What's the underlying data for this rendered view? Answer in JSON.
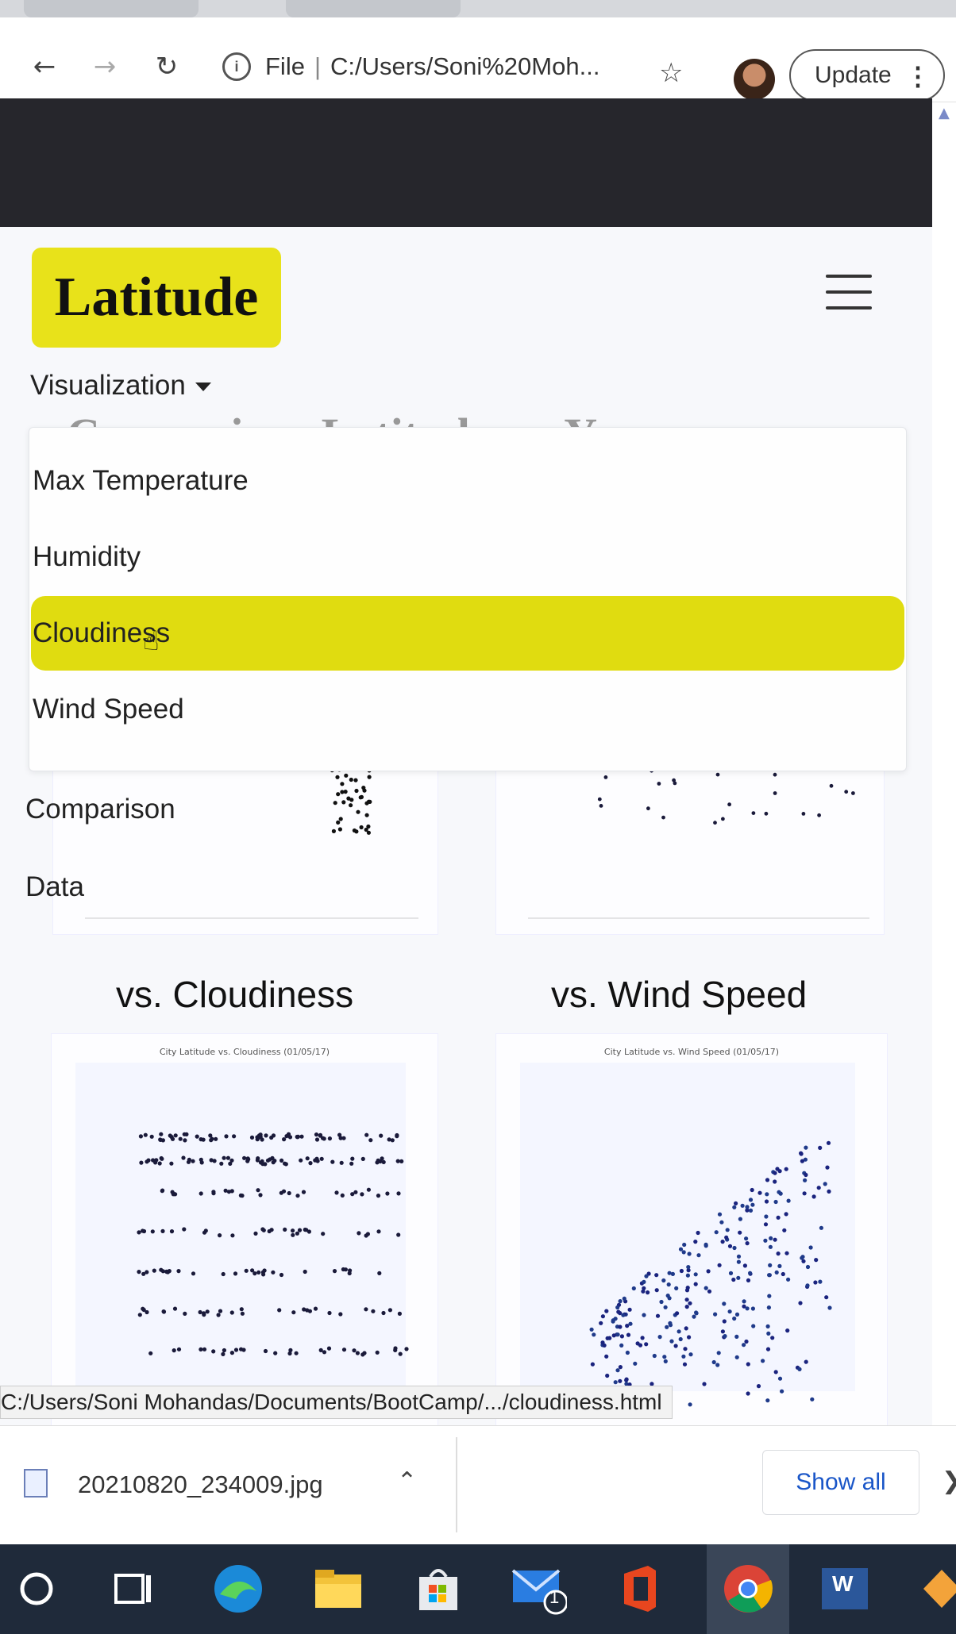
{
  "browser": {
    "address_prefix": "File",
    "address_path": "C:/Users/Soni%20Moh...",
    "update_label": "Update"
  },
  "page": {
    "brand": "Latitude",
    "visualization_label": "Visualization",
    "heading_partial": "Comparison Latitude vs. Y",
    "dropdown": [
      {
        "label": "Max Temperature"
      },
      {
        "label": "Humidity"
      },
      {
        "label": "Cloudiness",
        "active": true
      },
      {
        "label": "Wind Speed"
      }
    ],
    "nav_links": [
      "Comparison",
      "Data"
    ],
    "sections": [
      {
        "title": "vs. Cloudiness"
      },
      {
        "title": "vs. Wind Speed"
      }
    ],
    "chart_titles": [
      "City Latitude vs. Cloudiness (01/05/17)",
      "City Latitude vs. Wind Speed (01/05/17)"
    ]
  },
  "status_url": "C:/Users/Soni Mohandas/Documents/BootCamp/.../cloudiness.html",
  "downloads": {
    "file_name": "20210820_234009.jpg",
    "show_all": "Show all"
  },
  "taskbar": {
    "mail_badge": "1",
    "word_label": "W"
  },
  "colors": {
    "accent_yellow": "#e8e21a",
    "dark_band": "#26262c",
    "taskbar": "#1f2a3a",
    "link_blue": "#1a56c8"
  }
}
